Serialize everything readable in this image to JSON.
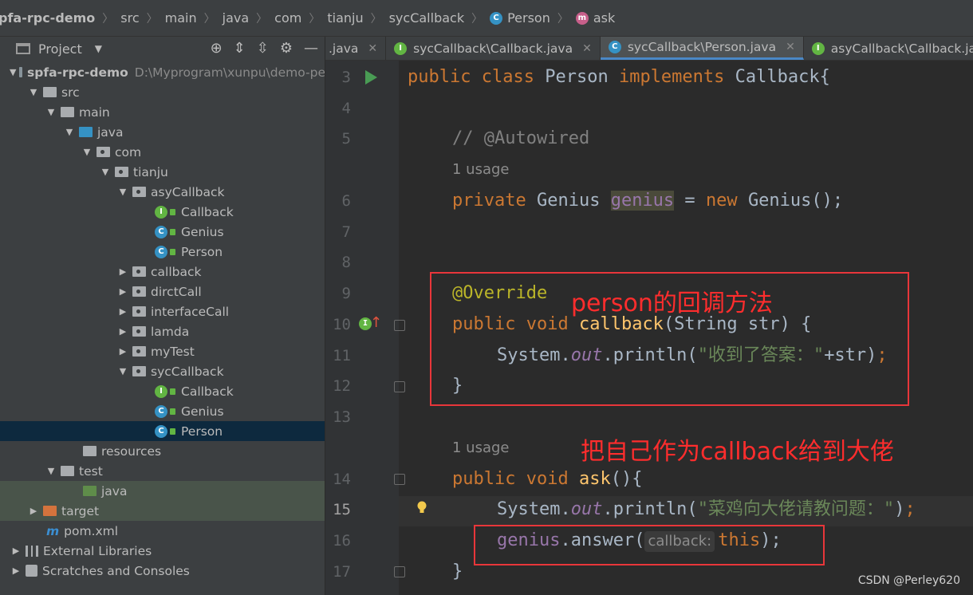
{
  "breadcrumb": {
    "project": "pfa-rpc-demo",
    "items": [
      "src",
      "main",
      "java",
      "com",
      "tianju",
      "sycCallback"
    ],
    "class_name": "Person",
    "method_name": "ask"
  },
  "panel": {
    "title": "Project",
    "tree": [
      {
        "label": "spfa-rpc-demo",
        "extra": "D:\\Myprogram\\xunpu\\demo-pe"
      },
      {
        "label": "src"
      },
      {
        "label": "main"
      },
      {
        "label": "java"
      },
      {
        "label": "com"
      },
      {
        "label": "tianju"
      },
      {
        "label": "asyCallback"
      },
      {
        "label": "Callback"
      },
      {
        "label": "Genius"
      },
      {
        "label": "Person"
      },
      {
        "label": "callback"
      },
      {
        "label": "dirctCall"
      },
      {
        "label": "interfaceCall"
      },
      {
        "label": "lamda"
      },
      {
        "label": "myTest"
      },
      {
        "label": "sycCallback"
      },
      {
        "label": "Callback"
      },
      {
        "label": "Genius"
      },
      {
        "label": "Person"
      },
      {
        "label": "resources"
      },
      {
        "label": "test"
      },
      {
        "label": "java"
      },
      {
        "label": "target"
      },
      {
        "label": "pom.xml"
      },
      {
        "label": "External Libraries"
      },
      {
        "label": "Scratches and Consoles"
      }
    ]
  },
  "tabs": [
    {
      "label": ".java"
    },
    {
      "label": "sycCallback\\Callback.java"
    },
    {
      "label": "sycCallback\\Person.java"
    },
    {
      "label": "asyCallback\\Callback.java"
    }
  ],
  "editor": {
    "line_numbers": [
      "3",
      "4",
      "5",
      "6",
      "7",
      "8",
      "9",
      "10",
      "11",
      "12",
      "13",
      "14",
      "15",
      "16",
      "17"
    ],
    "usage_label": "1 usage",
    "param_hint": "callback:",
    "t": {
      "public": "public",
      "class": "class",
      "implements": "implements",
      "private": "private",
      "new": "new",
      "void": "void",
      "Person": "Person",
      "Callback": "Callback{",
      "comment": "// @Autowired",
      "Genius": "Genius",
      "genius": "genius",
      "eq": " = ",
      "GeniusCall": "Genius();",
      "override": "@Override",
      "callback": "callback",
      "params": "(String str) {",
      "System": "System.",
      "out": "out",
      "println": ".println(",
      "str1": "\"收到了答案：\"",
      "plusstr": "+str)",
      "semi": ";",
      "close": "}",
      "ask": "ask",
      "askparen": "(){",
      "str2": "\"菜鸡向大佬请教问题：\"",
      "paren": ")",
      "answer": ".answer(",
      "this": "this",
      "parensemi": ");"
    }
  },
  "annotations": {
    "note1": "person的回调方法",
    "note2": "把自己作为callback给到大佬"
  },
  "watermark": "CSDN @Perley620"
}
